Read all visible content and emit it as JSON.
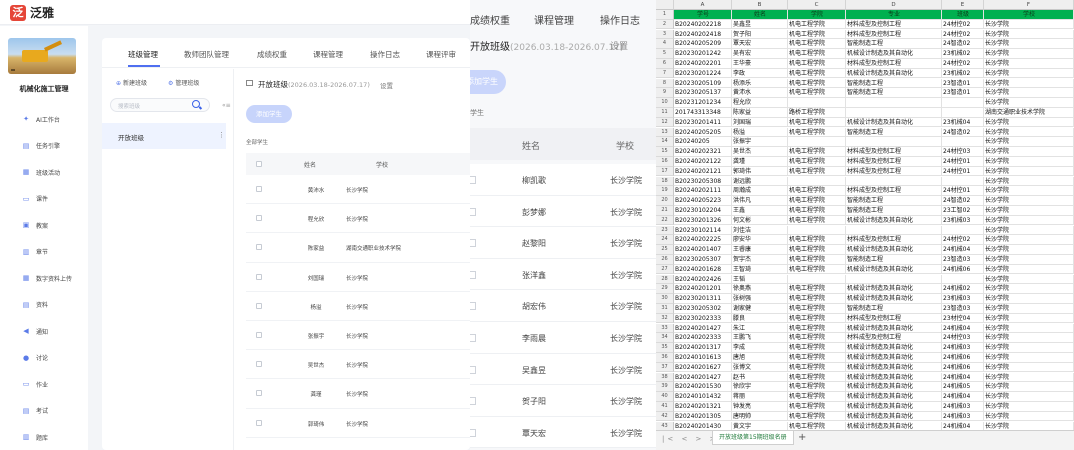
{
  "appA": {
    "brand": "泛雅",
    "course_name": "机械化施工管理",
    "course_image_label": "",
    "nav": [
      {
        "icon": "ai-icon",
        "label": "AI工作台"
      },
      {
        "icon": "task-icon",
        "label": "任务引擎"
      },
      {
        "icon": "activity-icon",
        "label": "班级活动"
      },
      {
        "icon": "courseware-icon",
        "label": "课件"
      },
      {
        "icon": "lesson-plan-icon",
        "label": "教案"
      },
      {
        "icon": "chapter-icon",
        "label": "章节"
      },
      {
        "icon": "upload-icon",
        "label": "数字资料上传"
      },
      {
        "icon": "material-icon",
        "label": "资料"
      },
      {
        "icon": "notice-icon",
        "label": "通知"
      },
      {
        "icon": "discussion-icon",
        "label": "讨论"
      },
      {
        "icon": "homework-icon",
        "label": "作业"
      },
      {
        "icon": "exam-icon",
        "label": "考试"
      },
      {
        "icon": "question-bank-icon",
        "label": "题库"
      }
    ],
    "tabs": [
      "班级管理",
      "教师团队管理",
      "成绩权重",
      "课程管理",
      "操作日志",
      "课程评审"
    ],
    "new_class": "新建班级",
    "manage_class": "管理班级",
    "search_placeholder": "搜索班级",
    "collapse": "«≡",
    "class_item": "开放班级",
    "class_title": "开放班级",
    "class_dates": "(2026.03.18-2026.07.17)",
    "settings": "设置",
    "add_student": "添加学生",
    "all_students": "全部学生",
    "col_name": "姓名",
    "col_school": "学校",
    "students": [
      {
        "name": "黄沛水",
        "school": "长沙学院"
      },
      {
        "name": "程允欣",
        "school": "长沙学院"
      },
      {
        "name": "陈家益",
        "school": "湖南交通职业技术学院"
      },
      {
        "name": "刘国瑞",
        "school": "长沙学院"
      },
      {
        "name": "杨溢",
        "school": "长沙学院"
      },
      {
        "name": "张振宇",
        "school": "长沙学院"
      },
      {
        "name": "吴世杰",
        "school": "长沙学院"
      },
      {
        "name": "龚瑾",
        "school": "长沙学院"
      },
      {
        "name": "郭琦伟",
        "school": "长沙学院"
      }
    ]
  },
  "appB": {
    "tabs": [
      "成绩权重",
      "课程管理",
      "操作日志"
    ],
    "class_title": "开放班级",
    "class_dates": "(2026.03.18-2026.07.17)",
    "settings": "设置",
    "add_student": "添加学生",
    "all_students": "学生",
    "col_name": "姓名",
    "col_school": "学校",
    "students": [
      {
        "name": "柳凯歌",
        "school": "长沙学院"
      },
      {
        "name": "彭梦娜",
        "school": "长沙学院"
      },
      {
        "name": "赵黎阳",
        "school": "长沙学院"
      },
      {
        "name": "张洋鑫",
        "school": "长沙学院"
      },
      {
        "name": "胡宏伟",
        "school": "长沙学院"
      },
      {
        "name": "李雨晨",
        "school": "长沙学院"
      },
      {
        "name": "吴鑫昱",
        "school": "长沙学院"
      },
      {
        "name": "贺子阳",
        "school": "长沙学院"
      },
      {
        "name": "覃天宏",
        "school": "长沙学院"
      }
    ]
  },
  "sheet": {
    "columns": [
      "A",
      "B",
      "C",
      "D",
      "E",
      "F"
    ],
    "header": [
      "学号",
      "姓名",
      "学院",
      "专业",
      "班级",
      "学校"
    ],
    "rows": [
      [
        "B20240202218",
        "吴鑫昱",
        "机电工程学院",
        "材料成型及控制工程",
        "24材控02",
        "长沙学院"
      ],
      [
        "B20240202418",
        "贺子阳",
        "机电工程学院",
        "材料成型及控制工程",
        "24材控02",
        "长沙学院"
      ],
      [
        "B20240205209",
        "覃天宏",
        "机电工程学院",
        "智能制造工程",
        "24智造02",
        "长沙学院"
      ],
      [
        "B20230201242",
        "吴有宏",
        "机电工程学院",
        "机械设计制造及其自动化",
        "23机械02",
        "长沙学院"
      ],
      [
        "B20240202201",
        "王华豪",
        "机电工程学院",
        "材料成型及控制工程",
        "24材控02",
        "长沙学院"
      ],
      [
        "B20230201224",
        "李政",
        "机电工程学院",
        "机械设计制造及其自动化",
        "23机械02",
        "长沙学院"
      ],
      [
        "B20230205109",
        "杨添乐",
        "机电工程学院",
        "智能制造工程",
        "23智造01",
        "长沙学院"
      ],
      [
        "B20230205137",
        "黄沛水",
        "机电工程学院",
        "智能制造工程",
        "23智造01",
        "长沙学院"
      ],
      [
        "B20231201234",
        "程允欣",
        "",
        "",
        "",
        "长沙学院"
      ],
      [
        "201743313348",
        "陈家益",
        "路桥工程学院",
        "",
        "",
        "湖南交通职业技术学院"
      ],
      [
        "B20230201411",
        "刘国瑞",
        "机电工程学院",
        "机械设计制造及其自动化",
        "23机械04",
        "长沙学院"
      ],
      [
        "B20240205205",
        "杨溢",
        "机电工程学院",
        "智能制造工程",
        "24智造02",
        "长沙学院"
      ],
      [
        "B20240205",
        "张振宇",
        "",
        "",
        "",
        "长沙学院"
      ],
      [
        "B20240202321",
        "吴世杰",
        "机电工程学院",
        "材料成型及控制工程",
        "24材控03",
        "长沙学院"
      ],
      [
        "B20240202122",
        "龚瑾",
        "机电工程学院",
        "材料成型及控制工程",
        "24材控01",
        "长沙学院"
      ],
      [
        "B20240202121",
        "郭琦伟",
        "机电工程学院",
        "材料成型及控制工程",
        "24材控01",
        "长沙学院"
      ],
      [
        "B20230205308",
        "谢远鹏",
        "",
        "",
        "",
        "长沙学院"
      ],
      [
        "B20240202111",
        "周瀚成",
        "机电工程学院",
        "材料成型及控制工程",
        "24材控01",
        "长沙学院"
      ],
      [
        "B20240205223",
        "洪伟凡",
        "机电工程学院",
        "智能制造工程",
        "24智造02",
        "长沙学院"
      ],
      [
        "B20230102204",
        "王鑫",
        "机电工程学院",
        "智能制造工程",
        "23工智02",
        "长沙学院"
      ],
      [
        "B20230201326",
        "何文彬",
        "机电工程学院",
        "机械设计制造及其自动化",
        "23机械03",
        "长沙学院"
      ],
      [
        "B20230102114",
        "刘佳洁",
        "",
        "",
        "",
        "长沙学院"
      ],
      [
        "B20240202225",
        "廖安华",
        "机电工程学院",
        "材料成型及控制工程",
        "24材控02",
        "长沙学院"
      ],
      [
        "B20240201407",
        "王睿康",
        "机电工程学院",
        "机械设计制造及其自动化",
        "24机械04",
        "长沙学院"
      ],
      [
        "B20230205307",
        "贺宇杰",
        "机电工程学院",
        "智能制造工程",
        "23智造03",
        "长沙学院"
      ],
      [
        "B20240201628",
        "王智琦",
        "机电工程学院",
        "机械设计制造及其自动化",
        "24机械06",
        "长沙学院"
      ],
      [
        "B20240202426",
        "王韬",
        "",
        "",
        "",
        "长沙学院"
      ],
      [
        "B20240201201",
        "徐奥燕",
        "机电工程学院",
        "机械设计制造及其自动化",
        "24机械02",
        "长沙学院"
      ],
      [
        "B20230201311",
        "张树强",
        "机电工程学院",
        "机械设计制造及其自动化",
        "23机械03",
        "长沙学院"
      ],
      [
        "B20230205302",
        "谢家健",
        "机电工程学院",
        "智能制造工程",
        "23智造03",
        "长沙学院"
      ],
      [
        "B20230202333",
        "滕良",
        "机电工程学院",
        "材料成型及控制工程",
        "23材控04",
        "长沙学院"
      ],
      [
        "B20240201427",
        "朱江",
        "机电工程学院",
        "机械设计制造及其自动化",
        "24机械04",
        "长沙学院"
      ],
      [
        "B20240202333",
        "王鹏飞",
        "机电工程学院",
        "材料成型及控制工程",
        "24材控03",
        "长沙学院"
      ],
      [
        "B20240201317",
        "李成",
        "机电工程学院",
        "机械设计制造及其自动化",
        "24机械03",
        "长沙学院"
      ],
      [
        "B20240101613",
        "唐旭",
        "机电工程学院",
        "机械设计制造及其自动化",
        "24机械06",
        "长沙学院"
      ],
      [
        "B20240201627",
        "张博文",
        "机电工程学院",
        "机械设计制造及其自动化",
        "24机械06",
        "长沙学院"
      ],
      [
        "B20240201427",
        "赵书",
        "机电工程学院",
        "机械设计制造及其自动化",
        "24机械04",
        "长沙学院"
      ],
      [
        "B20240201530",
        "徐欣宇",
        "机电工程学院",
        "机械设计制造及其自动化",
        "24机械05",
        "长沙学院"
      ],
      [
        "B20240101432",
        "蒋丽",
        "机电工程学院",
        "机械设计制造及其自动化",
        "24机械04",
        "长沙学院"
      ],
      [
        "B20240201321",
        "钟发亮",
        "机电工程学院",
        "机械设计制造及其自动化",
        "24机械03",
        "长沙学院"
      ],
      [
        "B20240201305",
        "唐明帅",
        "机电工程学院",
        "机械设计制造及其自动化",
        "24机械03",
        "长沙学院"
      ],
      [
        "B20240201430",
        "黄文宇",
        "机电工程学院",
        "机械设计制造及其自动化",
        "24机械04",
        "长沙学院"
      ]
    ],
    "sheet_tab": "开放班级第15期班级名册",
    "header_color": "#00b050"
  }
}
